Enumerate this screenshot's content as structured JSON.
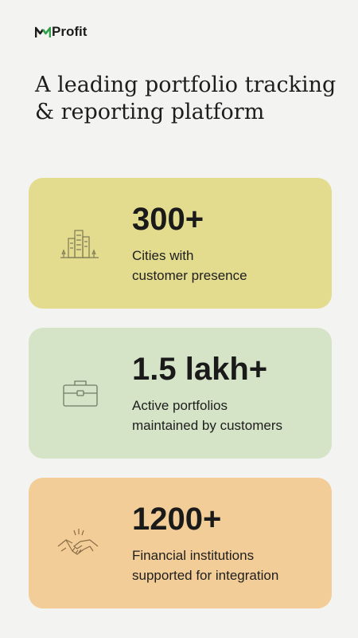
{
  "brand": {
    "m": "M",
    "name": "Profit",
    "accent": "#2f9e4a"
  },
  "headline": {
    "line1": "A leading portfolio tracking",
    "line2": "& reporting platform"
  },
  "stats": [
    {
      "value": "300+",
      "desc_line1": "Cities with",
      "desc_line2": "customer presence",
      "icon": "city-buildings-icon",
      "bg": "#e3db8e"
    },
    {
      "value": "1.5 lakh+",
      "desc_line1": "Active portfolios",
      "desc_line2": "maintained by customers",
      "icon": "briefcase-icon",
      "bg": "#d5e3c6"
    },
    {
      "value": "1200+",
      "desc_line1": "Financial institutions",
      "desc_line2": "supported for integration",
      "icon": "handshake-icon",
      "bg": "#f3cd97"
    }
  ]
}
